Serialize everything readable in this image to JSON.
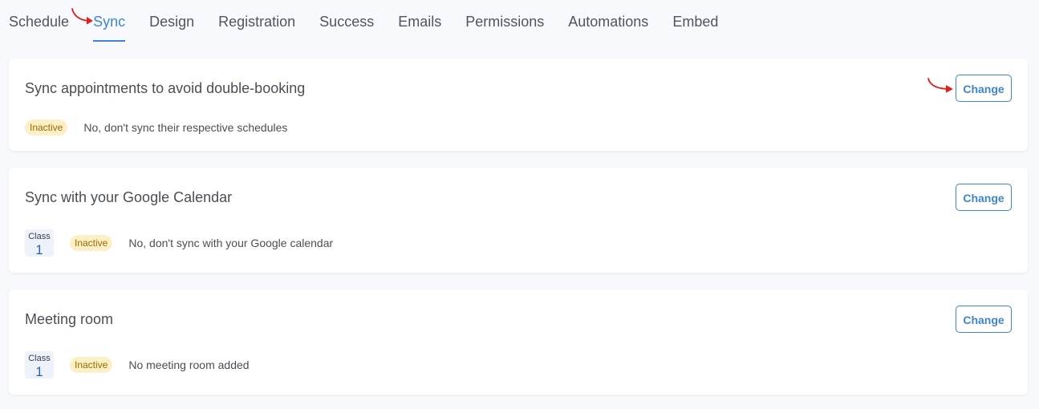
{
  "tabs": [
    {
      "label": "Schedule",
      "active": false
    },
    {
      "label": "Sync",
      "active": true
    },
    {
      "label": "Design",
      "active": false
    },
    {
      "label": "Registration",
      "active": false
    },
    {
      "label": "Success",
      "active": false
    },
    {
      "label": "Emails",
      "active": false
    },
    {
      "label": "Permissions",
      "active": false
    },
    {
      "label": "Automations",
      "active": false
    },
    {
      "label": "Embed",
      "active": false
    }
  ],
  "cards": [
    {
      "title": "Sync appointments to avoid double-booking",
      "button": "Change",
      "badge": "Inactive",
      "status": "No, don't sync their respective schedules"
    },
    {
      "title": "Sync with your Google Calendar",
      "button": "Change",
      "class_label": "Class",
      "class_number": "1",
      "badge": "Inactive",
      "status": "No, don't sync with your Google calendar"
    },
    {
      "title": "Meeting room",
      "button": "Change",
      "class_label": "Class",
      "class_number": "1",
      "badge": "Inactive",
      "status": "No meeting room added"
    }
  ],
  "colors": {
    "accent": "#3d86cf",
    "badge_bg": "#fdf0c7",
    "badge_text": "#9a6b00",
    "annotation_arrow": "#e0201b"
  },
  "annotations": [
    "arrow-pointing-sync-tab",
    "arrow-pointing-change-button"
  ]
}
